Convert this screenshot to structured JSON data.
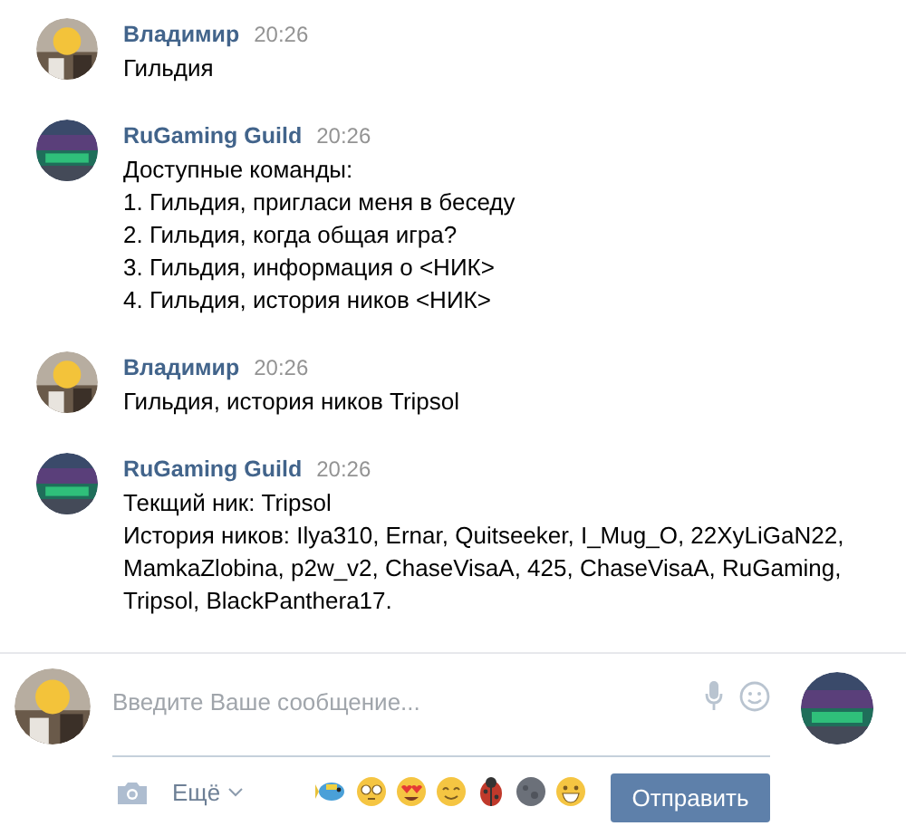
{
  "messages": [
    {
      "author": "Владимир",
      "time": "20:26",
      "kind": "user",
      "lines": [
        "Гильдия"
      ]
    },
    {
      "author": "RuGaming Guild",
      "time": "20:26",
      "kind": "guild",
      "lines": [
        "Доступные команды:",
        "1. Гильдия, пригласи меня в беседу",
        "2. Гильдия, когда общая игра?",
        "3. Гильдия, информация о <НИК>",
        "4. Гильдия, история ников <НИК>"
      ]
    },
    {
      "author": "Владимир",
      "time": "20:26",
      "kind": "user",
      "lines": [
        "Гильдия, история ников Tripsol"
      ]
    },
    {
      "author": "RuGaming Guild",
      "time": "20:26",
      "kind": "guild",
      "lines": [
        "Текщий ник: Tripsol",
        "История ников: Ilya310, Ernar, Quitseeker, I_Mug_O, 22XyLiGaN22, MamkaZlobina, p2w_v2, ChaseVisaA, 425, ChaseVisaA, RuGaming, Tripsol, BlackPanthera17."
      ]
    }
  ],
  "composer": {
    "placeholder": "Введите Ваше сообщение...",
    "more": "Ещё",
    "send": "Отправить",
    "emojis": [
      {
        "kind": "fish"
      },
      {
        "kind": "flushed"
      },
      {
        "kind": "hearts"
      },
      {
        "kind": "smile"
      },
      {
        "kind": "ladybug"
      },
      {
        "kind": "moon"
      },
      {
        "kind": "grin"
      }
    ]
  }
}
